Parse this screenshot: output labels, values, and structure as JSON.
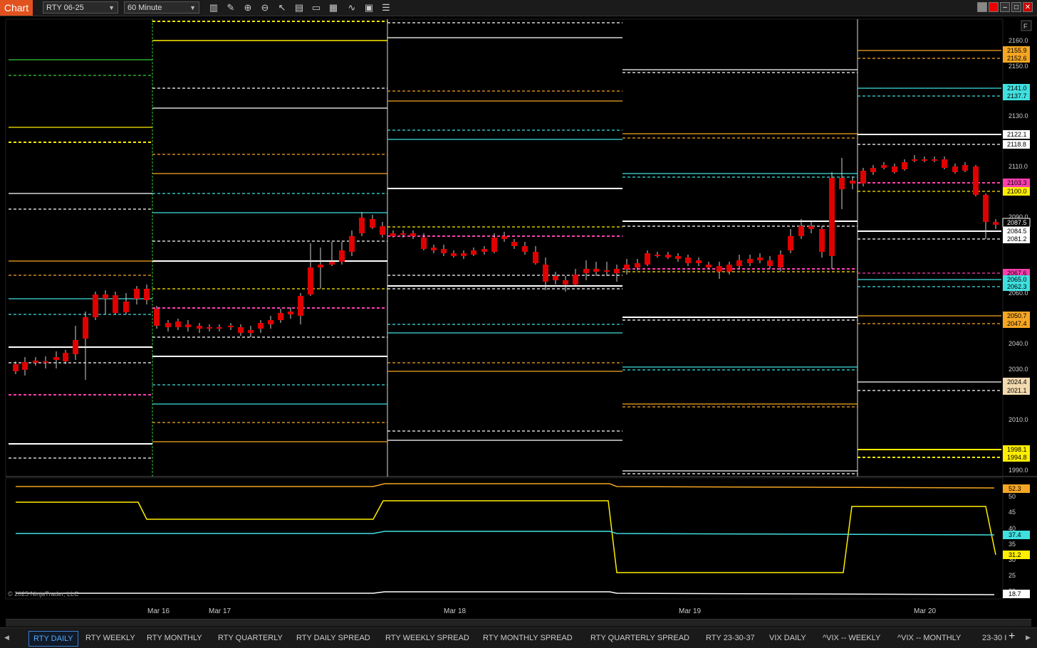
{
  "toolbar": {
    "chart_label": "Chart",
    "instrument": "RTY 06-25",
    "interval": "60 Minute",
    "icons": [
      "bar-style-icon",
      "draw-pencil-icon",
      "zoom-in-icon",
      "zoom-out-icon",
      "pointer-icon",
      "properties-icon",
      "templates-icon",
      "layout-icon",
      "indicators-icon",
      "strategies-icon",
      "list-icon"
    ]
  },
  "window_controls": [
    "restore-icon",
    "close-red-icon",
    "minimize-icon",
    "maximize-icon",
    "close-icon"
  ],
  "price_axis": {
    "ticks": [
      "2160.0",
      "2150.0",
      "2130.0",
      "2110.0",
      "2090.0",
      "2060.0",
      "2040.0",
      "2030.0",
      "2010.0",
      "1990.0"
    ],
    "f_marker": "F"
  },
  "price_tags": [
    {
      "text": "2155.9",
      "bg": "#f5a623",
      "fg": "#000"
    },
    {
      "text": "2152.6",
      "bg": "#f5a623",
      "fg": "#000"
    },
    {
      "text": "2141.0",
      "bg": "#40e0e0",
      "fg": "#000"
    },
    {
      "text": "2137.7",
      "bg": "#40e0e0",
      "fg": "#000"
    },
    {
      "text": "2122.1",
      "bg": "#ffffff",
      "fg": "#000"
    },
    {
      "text": "2118.8",
      "bg": "#ffffff",
      "fg": "#000"
    },
    {
      "text": "2103.3",
      "bg": "#ff3fb0",
      "fg": "#000"
    },
    {
      "text": "2100.0",
      "bg": "#ffee00",
      "fg": "#000"
    },
    {
      "text": "2087.5",
      "bg": "#000000",
      "fg": "#ffffff"
    },
    {
      "text": "2084.5",
      "bg": "#ffffff",
      "fg": "#000"
    },
    {
      "text": "2081.2",
      "bg": "#ffffff",
      "fg": "#000"
    },
    {
      "text": "2067.6",
      "bg": "#ff3fb0",
      "fg": "#000"
    },
    {
      "text": "2065.0",
      "bg": "#40e0e0",
      "fg": "#000"
    },
    {
      "text": "2062.3",
      "bg": "#40e0e0",
      "fg": "#000"
    },
    {
      "text": "2050.7",
      "bg": "#f5a623",
      "fg": "#000"
    },
    {
      "text": "2047.4",
      "bg": "#f5a623",
      "fg": "#000"
    },
    {
      "text": "2024.4",
      "bg": "#f2d9b0",
      "fg": "#000"
    },
    {
      "text": "2021.1",
      "bg": "#f2d9b0",
      "fg": "#000"
    },
    {
      "text": "1998.1",
      "bg": "#ffee00",
      "fg": "#000"
    },
    {
      "text": "1994.8",
      "bg": "#ffee00",
      "fg": "#000"
    }
  ],
  "lower_axis": {
    "ticks": [
      "50",
      "45",
      "40",
      "35",
      "30",
      "25",
      "20"
    ]
  },
  "lower_tags": [
    {
      "text": "52.3",
      "bg": "#f5a623",
      "fg": "#000"
    },
    {
      "text": "37.4",
      "bg": "#40e0e0",
      "fg": "#000"
    },
    {
      "text": "31.2",
      "bg": "#ffee00",
      "fg": "#000"
    },
    {
      "text": "18.7",
      "bg": "#ffffff",
      "fg": "#000"
    }
  ],
  "date_labels": [
    "Mar 16",
    "Mar 17",
    "Mar 18",
    "Mar 19",
    "Mar 20"
  ],
  "copyright": "© 2025 NinjaTrader, LLC",
  "tabs": [
    {
      "label": "RTY DAILY",
      "active": true
    },
    {
      "label": "RTY WEEKLY"
    },
    {
      "label": "RTY MONTHLY"
    },
    {
      "label": "RTY QUARTERLY"
    },
    {
      "label": "RTY DAILY SPREAD"
    },
    {
      "label": "RTY WEEKLY SPREAD"
    },
    {
      "label": "RTY MONTHLY SPREAD"
    },
    {
      "label": "RTY QUARTERLY SPREAD"
    },
    {
      "label": "RTY 23-30-37"
    },
    {
      "label": "VIX DAILY"
    },
    {
      "label": "^VIX -- WEEKLY"
    },
    {
      "label": "^VIX -- MONTHLY"
    },
    {
      "label": "23-30 I"
    }
  ],
  "tab_add": "+",
  "colors": {
    "background": "#000000",
    "white_level": "#ffffff",
    "yellow_level": "#ffee00",
    "orange_level": "#f5a623",
    "cyan_level": "#40e0e0",
    "magenta_level": "#ff3fb0",
    "green_level": "#33cc33",
    "candle_up": "#ffffff",
    "candle_down": "#e00000"
  }
}
